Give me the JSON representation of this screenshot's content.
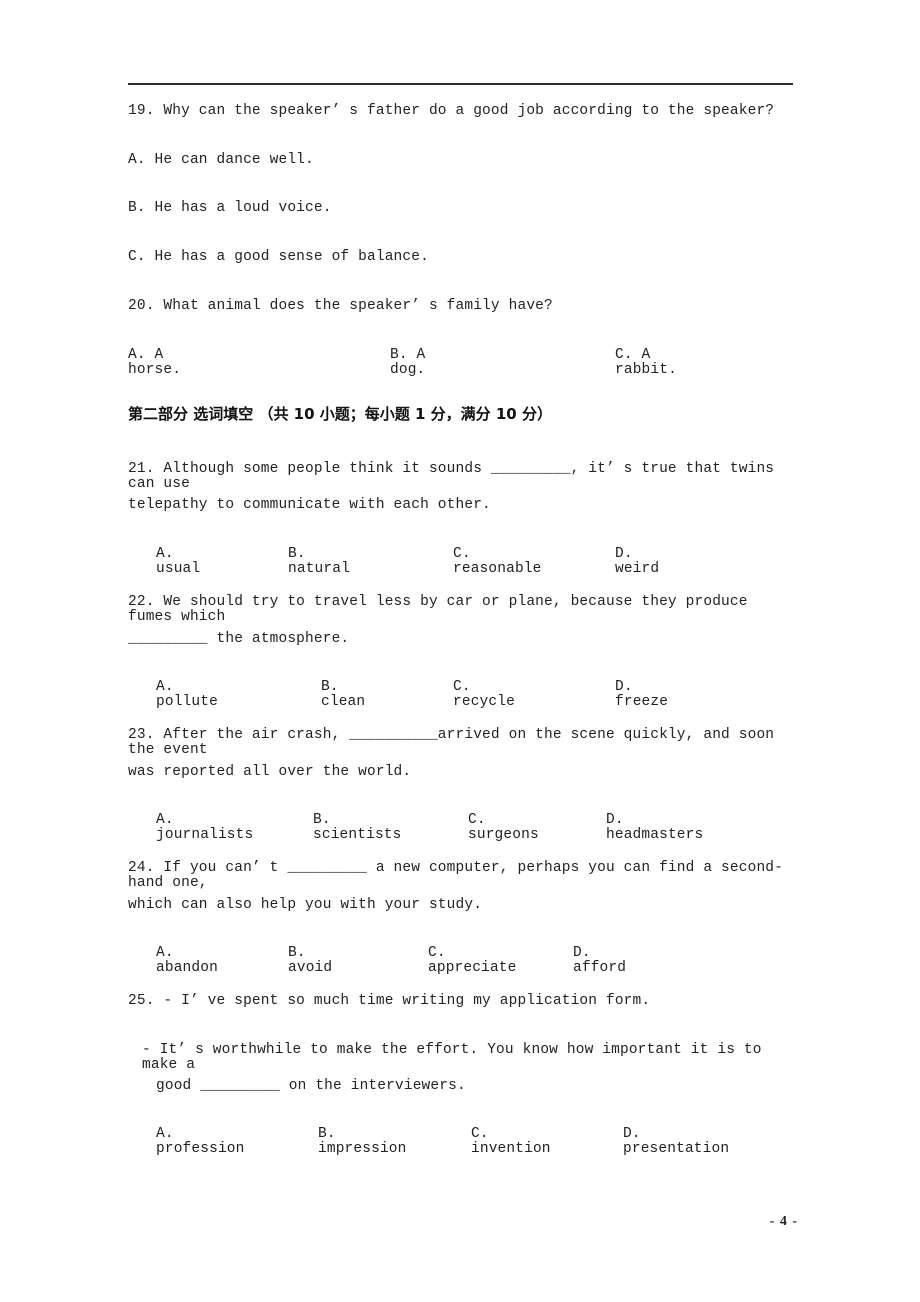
{
  "document": {
    "page_number_label": "- 4 -",
    "header_rule": true
  },
  "listening": {
    "questions": [
      {
        "number": "19.",
        "stem": "19. Why can the speaker’ s father do a good job according to the speaker?",
        "options_stacked": [
          "A. He can dance well.",
          "B. He has a loud voice.",
          "C. He has a good sense of balance."
        ]
      },
      {
        "number": "20.",
        "stem": "20. What animal does the speaker’ s family have?",
        "options_inline": [
          "A. A horse.",
          "B. A dog.",
          "C. A rabbit."
        ]
      }
    ]
  },
  "section": {
    "heading": "第二部分 选词填空 （共 10 小题；每小题 1 分，满分 10 分）"
  },
  "cloze": {
    "questions": [
      {
        "number": "21.",
        "stem_line1": "21. Although some people think it sounds _________, it’ s true that twins can use",
        "stem_line2": "telepathy to communicate with each other.",
        "options": [
          "A. usual",
          "B. natural",
          "C. reasonable",
          "D. weird"
        ]
      },
      {
        "number": "22.",
        "stem_line1": "22. We should try to travel less by car or plane, because they produce fumes which",
        "stem_line2": "_________ the atmosphere.",
        "options": [
          "A. pollute",
          "B. clean",
          "C. recycle",
          "D. freeze"
        ]
      },
      {
        "number": "23.",
        "stem_line1": "23. After the air crash, __________arrived on the scene quickly, and soon the event",
        "stem_line2": "was reported all over the world.",
        "options": [
          "A. journalists",
          "B. scientists",
          "C. surgeons",
          "D. headmasters"
        ]
      },
      {
        "number": "24.",
        "stem_line1": "24. If you can’ t _________ a new computer, perhaps you can find a second-hand one,",
        "stem_line2": "which can also help you with your study.",
        "options": [
          "A. abandon",
          "B. avoid",
          "C. appreciate",
          "D. afford"
        ]
      },
      {
        "number": "25.",
        "stem_line1": "25. - I’ ve spent so much time writing my application form.",
        "stem_line2": "- It’ s worthwhile to make the effort. You know how important it is to make a",
        "stem_line3": "good _________ on the interviewers.",
        "options": [
          "A. profession",
          "B. impression",
          "C. invention",
          "D. presentation"
        ]
      }
    ]
  }
}
